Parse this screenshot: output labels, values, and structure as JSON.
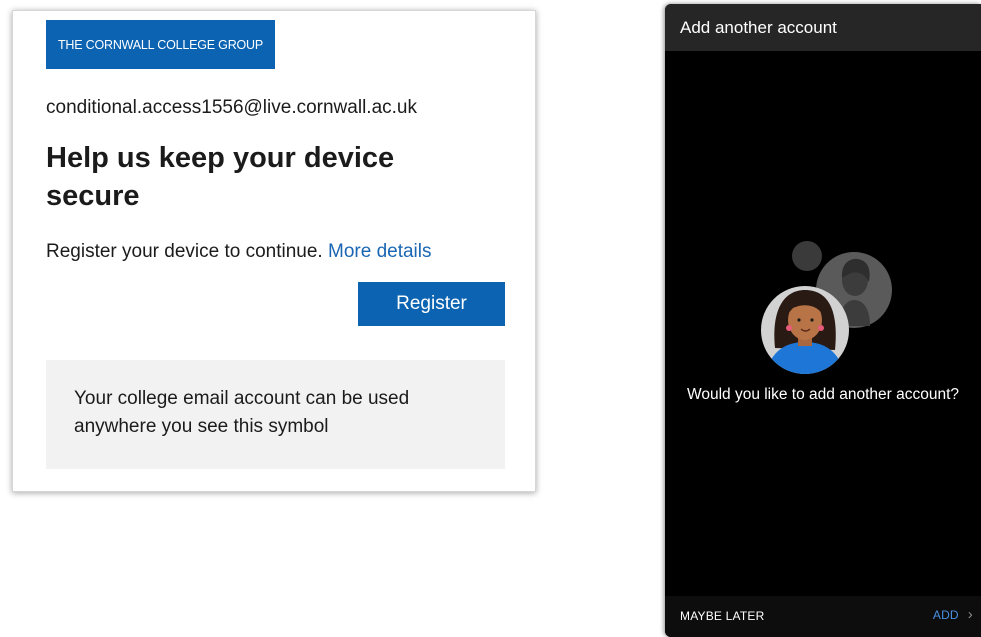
{
  "sign_in_card": {
    "brand_banner": "THE CORNWALL COLLEGE GROUP",
    "account_email": "conditional.access1556@live.cornwall.ac.uk",
    "title": "Help us keep your device secure",
    "register_prompt": "Register your device to continue.",
    "more_details_link": "More details",
    "register_button": "Register",
    "info_box_text": "Your college email account can be used anywhere you see this symbol"
  },
  "phone_screen": {
    "header_title": "Add another account",
    "prompt": "Would you like to add another account?",
    "maybe_later_button": "MAYBE LATER",
    "add_button": "ADD",
    "add_icon": "chevron-right-icon",
    "illustration_icon": "two-person-avatars-illustration"
  },
  "colors": {
    "brand_blue": "#0b63b1",
    "link_blue": "#1a66b3",
    "phone_background": "#000000",
    "add_blue": "#4a90e2"
  }
}
